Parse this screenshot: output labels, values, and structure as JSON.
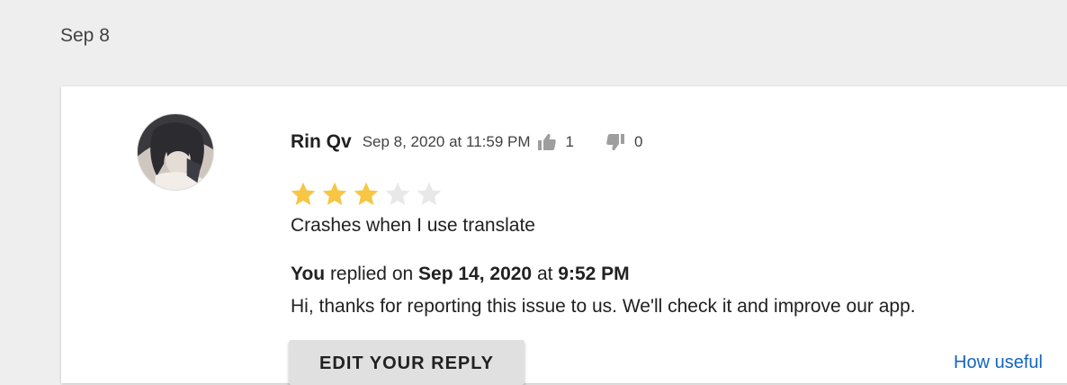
{
  "date_header": "Sep 8",
  "review": {
    "author": "Rin Qv",
    "date": "Sep 8, 2020 at 11:59 PM",
    "likes": "1",
    "dislikes": "0",
    "rating": 3,
    "rating_max": 5,
    "text": "Crashes when I use translate"
  },
  "reply": {
    "author_label": "You",
    "replied_on_label": " replied on ",
    "date": "Sep 14, 2020",
    "at_label": " at ",
    "time": "9:52 PM",
    "text": "Hi, thanks for reporting this issue to us. We'll check it and improve our app."
  },
  "edit_reply_label": "EDIT YOUR REPLY",
  "help_link": "How useful",
  "colors": {
    "star_filled": "#f6c644",
    "star_empty": "#e8e8e8",
    "thumb": "#9e9e9e",
    "link": "#1565c0"
  },
  "icons": [
    "thumbs-up-icon",
    "thumbs-down-icon",
    "star-icon"
  ]
}
